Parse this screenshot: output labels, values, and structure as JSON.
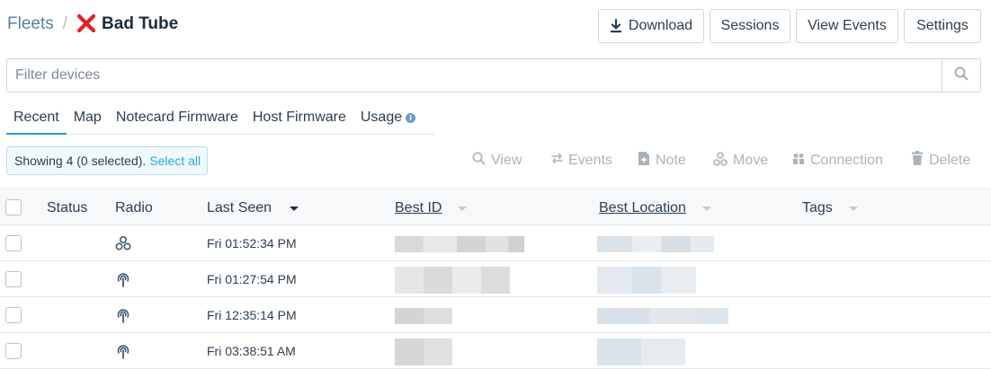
{
  "breadcrumb": {
    "root": "Fleets",
    "separator": "/",
    "title": "Bad Tube",
    "title_icon": "red-x-icon"
  },
  "toolbar": {
    "download": "Download",
    "sessions": "Sessions",
    "view_events": "View Events",
    "settings": "Settings"
  },
  "filter": {
    "placeholder": "Filter devices",
    "value": ""
  },
  "tabs": [
    {
      "label": "Recent",
      "active": true
    },
    {
      "label": "Map"
    },
    {
      "label": "Notecard Firmware"
    },
    {
      "label": "Host Firmware"
    },
    {
      "label": "Usage",
      "icon": "info-icon"
    }
  ],
  "selection": {
    "text": "Showing 4 (0 selected).",
    "select_all": "Select all"
  },
  "actions": {
    "view": "View",
    "events": "Events",
    "note": "Note",
    "move": "Move",
    "connection": "Connection",
    "delete": "Delete"
  },
  "table": {
    "columns": {
      "status": "Status",
      "radio": "Radio",
      "last_seen": "Last Seen",
      "best_id": "Best ID",
      "best_location": "Best Location",
      "tags": "Tags"
    },
    "sort": {
      "column": "last_seen",
      "direction": "desc"
    },
    "rows": [
      {
        "radio_icon": "wifi-icon",
        "last_seen": "Fri 01:52:34 PM"
      },
      {
        "radio_icon": "cellular-icon",
        "last_seen": "Fri 01:27:54 PM"
      },
      {
        "radio_icon": "cellular-icon",
        "last_seen": "Fri 12:35:14 PM"
      },
      {
        "radio_icon": "cellular-icon",
        "last_seen": "Fri 03:38:51 AM"
      }
    ]
  },
  "colors": {
    "accent": "#2d9bd6",
    "link": "#25a9d9",
    "breadcrumb_link": "#5b7fa3",
    "error_x": "#e0202a",
    "disabled_action": "#a9b3bc"
  }
}
